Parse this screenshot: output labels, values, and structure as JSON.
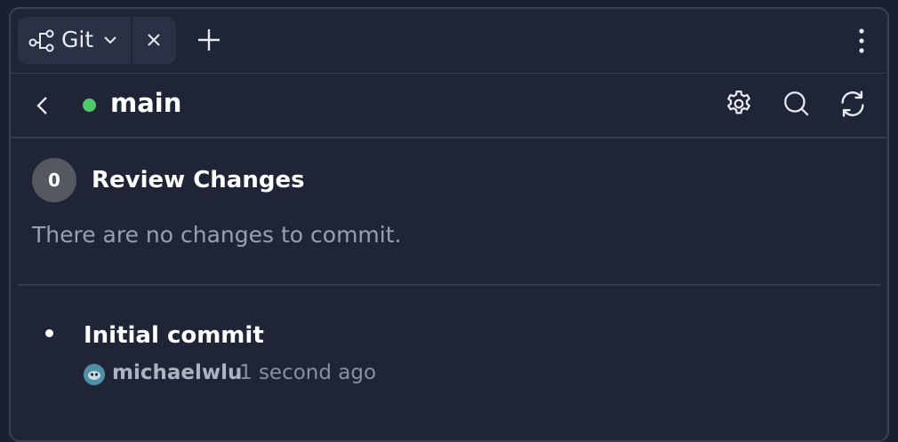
{
  "tab": {
    "label": "Git"
  },
  "branch": {
    "name": "main",
    "status_color": "#4fc96b"
  },
  "review": {
    "count": "0",
    "title": "Review Changes",
    "empty_message": "There are no changes to commit."
  },
  "commits": [
    {
      "message": "Initial commit",
      "author": "michaelwlu",
      "time": "1 second ago"
    }
  ],
  "icons": {
    "tab": "git-branch-icon",
    "chevron": "chevron-down-icon",
    "close": "close-icon",
    "new_tab": "plus-icon",
    "more": "more-vertical-icon",
    "back": "chevron-left-icon",
    "settings": "gear-icon",
    "search": "search-icon",
    "refresh": "refresh-icon"
  }
}
